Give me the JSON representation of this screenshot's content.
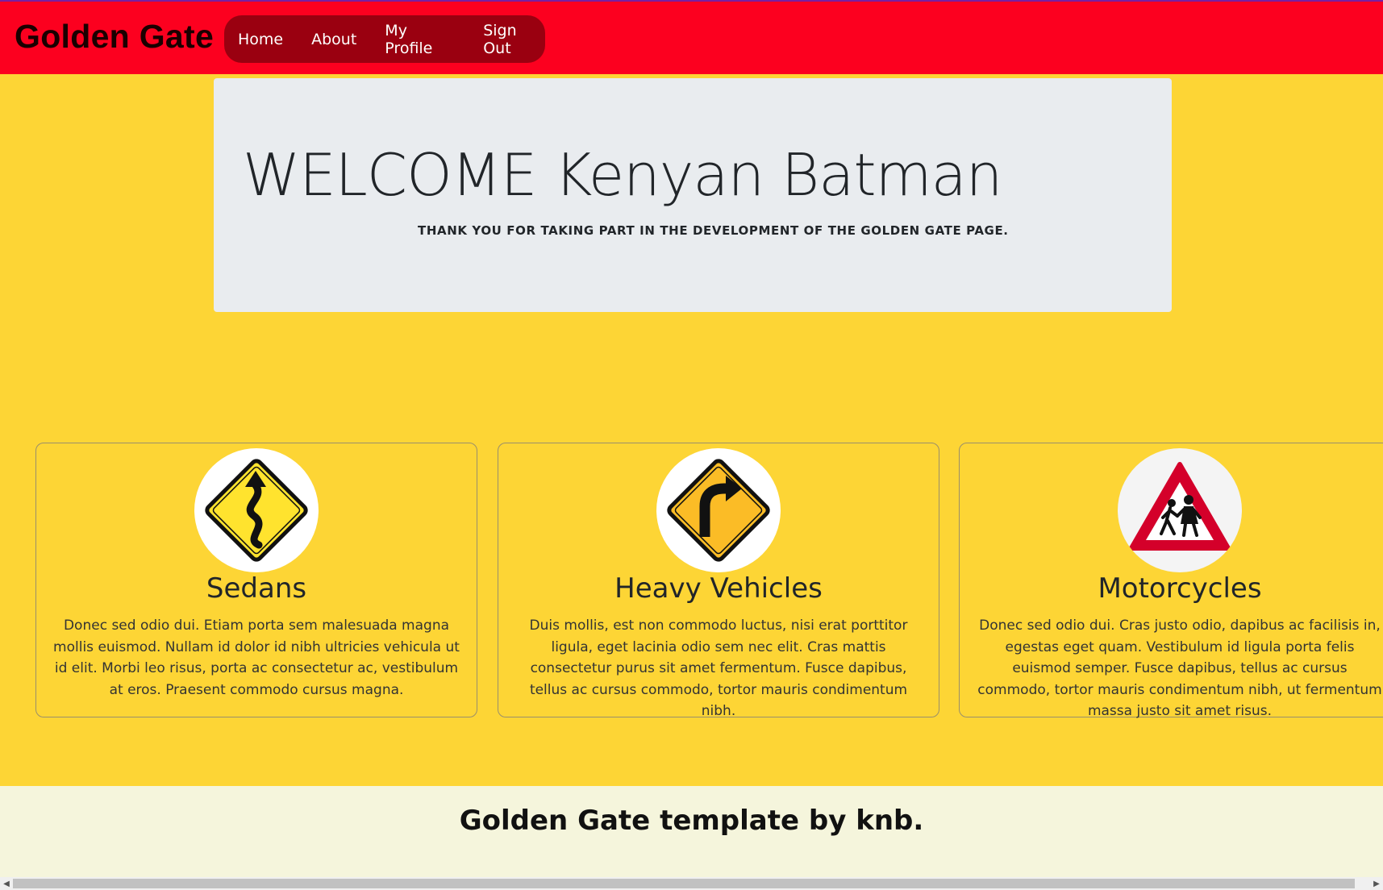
{
  "brand": "Golden Gate",
  "nav": {
    "home": "Home",
    "about": "About",
    "profile": "My Profile",
    "signout": "Sign Out"
  },
  "jumbotron": {
    "title": "WELCOME Kenyan Batman",
    "subtitle": "THANK YOU FOR TAKING PART IN THE DEVELOPMENT OF THE GOLDEN GATE PAGE."
  },
  "cards": [
    {
      "title": "Sedans",
      "icon": "winding-road-sign-icon",
      "text": "Donec sed odio dui. Etiam porta sem malesuada magna mollis euismod. Nullam id dolor id nibh ultricies vehicula ut id elit. Morbi leo risus, porta ac consectetur ac, vestibulum at eros. Praesent commodo cursus magna."
    },
    {
      "title": "Heavy Vehicles",
      "icon": "right-turn-sign-icon",
      "text": "Duis mollis, est non commodo luctus, nisi erat porttitor ligula, eget lacinia odio sem nec elit. Cras mattis consectetur purus sit amet fermentum. Fusce dapibus, tellus ac cursus commodo, tortor mauris condimentum nibh."
    },
    {
      "title": "Motorcycles",
      "icon": "children-crossing-sign-icon",
      "text": "Donec sed odio dui. Cras justo odio, dapibus ac facilisis in, egestas eget quam. Vestibulum id ligula porta felis euismod semper. Fusce dapibus, tellus ac cursus commodo, tortor mauris condimentum nibh, ut fermentum massa justo sit amet risus."
    }
  ],
  "footer": "Golden Gate template by knb.",
  "colors": {
    "navbar": "#fc001f",
    "nav_pill": "#9a0010",
    "page_bg": "#fdd535",
    "jumbotron_bg": "#e9ecef",
    "footer_bg": "#f5f5dc"
  }
}
